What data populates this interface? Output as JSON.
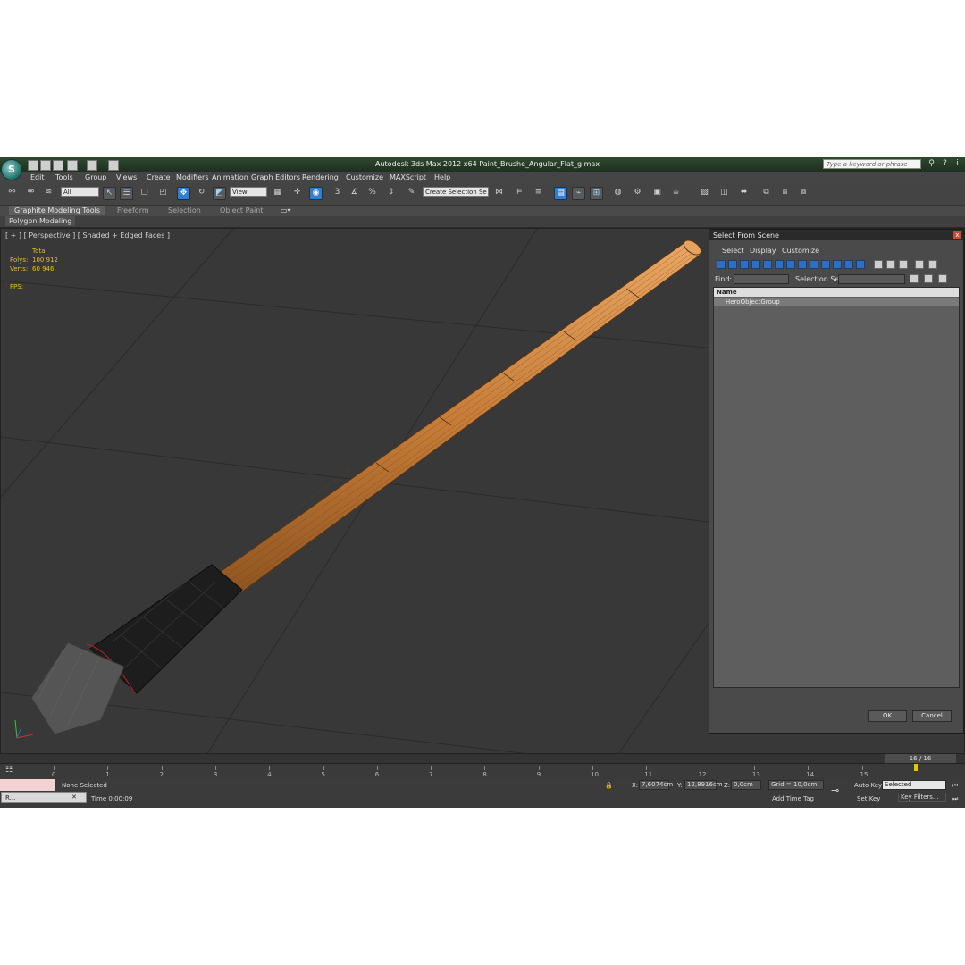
{
  "app": {
    "logo_letter": "S",
    "title": "Autodesk 3ds Max  2012 x64      Paint_Brushe_Angular_Flat_g.max",
    "search_placeholder": "Type a keyword or phrase"
  },
  "menu": [
    "Edit",
    "Tools",
    "Group",
    "Views",
    "Create",
    "Modifiers",
    "Animation",
    "Graph Editors",
    "Rendering",
    "Customize",
    "MAXScript",
    "Help"
  ],
  "toolbar": {
    "filter_value": "All",
    "ref_coord_value": "View",
    "named_selection_value": "Create Selection Se",
    "snap_label": "3"
  },
  "ribbon": {
    "tabs": [
      "Graphite Modeling Tools",
      "Freeform",
      "Selection",
      "Object Paint"
    ],
    "panel_label": "Polygon Modeling"
  },
  "viewport": {
    "label": "[ + ] [ Perspective ] [ Shaded + Edged Faces ]",
    "stats": {
      "total_label": "Total",
      "polys_label": "Polys:",
      "polys_value": "100 912",
      "verts_label": "Verts:",
      "verts_value": "60 946",
      "fps_label": "FPS:"
    }
  },
  "dialog": {
    "title": "Select From Scene",
    "close_glyph": "x",
    "menu": [
      "Select",
      "Display",
      "Customize"
    ],
    "find_label": "Find:",
    "selection_set_label": "Selection Set:",
    "column_header": "Name",
    "items": [
      "HeroObjectGroup"
    ],
    "ok_label": "OK",
    "cancel_label": "Cancel"
  },
  "timeline": {
    "frame_display": "16 / 16",
    "ticks": [
      "0",
      "1",
      "2",
      "3",
      "4",
      "5",
      "6",
      "7",
      "8",
      "9",
      "10",
      "11",
      "12",
      "13",
      "14",
      "15"
    ],
    "current_frame": 16
  },
  "status": {
    "selection_text": "None Selected",
    "time_text": "Time  0:00:09",
    "x_label": "X:",
    "x_value": "7,6074cm",
    "y_label": "Y:",
    "y_value": "12,8916cm",
    "z_label": "Z:",
    "z_value": "0,0cm",
    "grid_text": "Grid = 10,0cm",
    "add_time_tag": "Add Time Tag",
    "auto_key": "Auto Key",
    "auto_key_select": "Selected",
    "set_key": "Set Key",
    "key_filters": "Key Filters...",
    "task_label": "R..."
  }
}
